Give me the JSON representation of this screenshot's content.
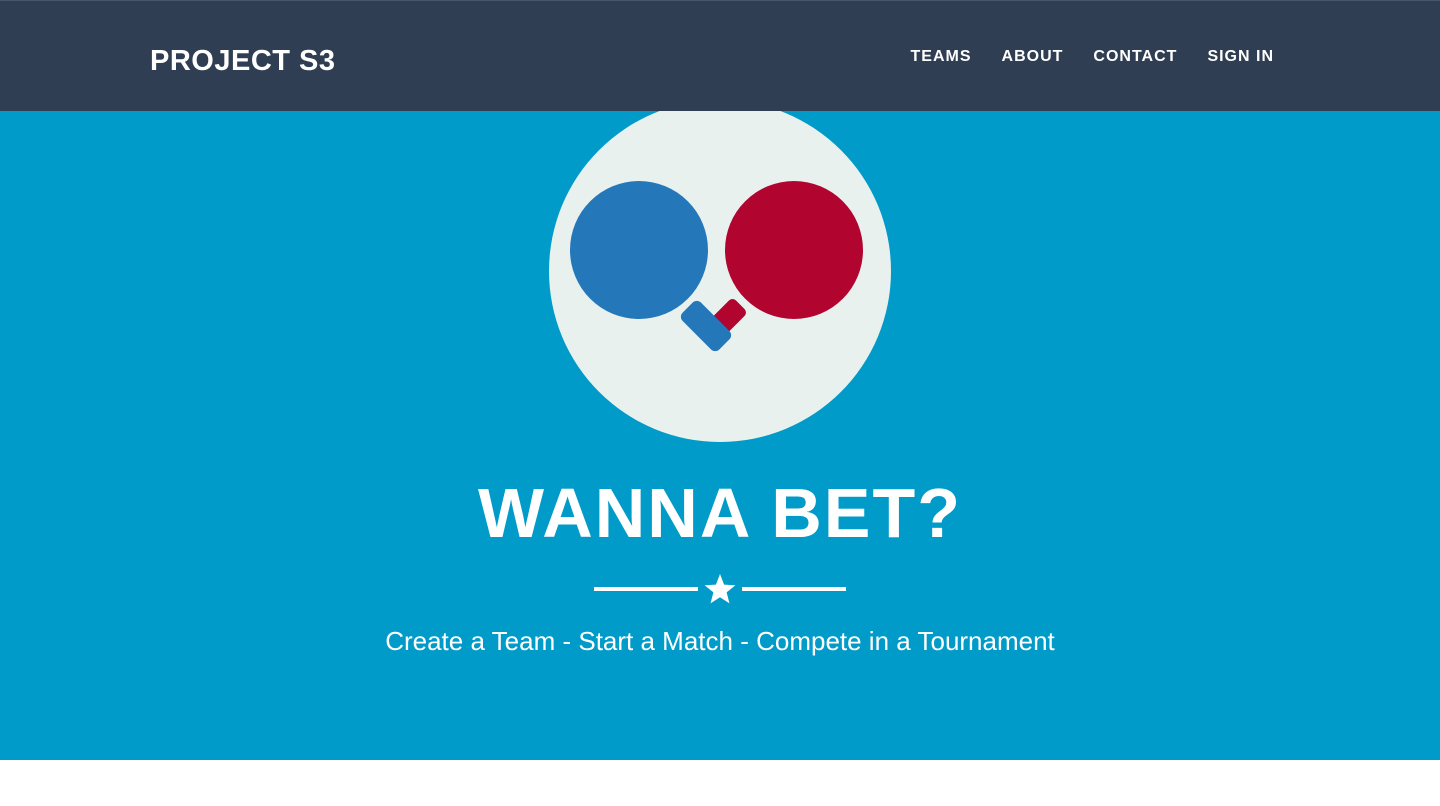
{
  "navbar": {
    "brand": "PROJECT S3",
    "links": [
      {
        "label": "TEAMS"
      },
      {
        "label": "ABOUT"
      },
      {
        "label": "CONTACT"
      },
      {
        "label": "SIGN IN"
      }
    ]
  },
  "hero": {
    "logo_icon": "ping-pong-paddles-icon",
    "headline": "WANNA BET?",
    "divider_icon": "star-icon",
    "tagline": "Create a Team - Start a Match - Compete in a Tournament"
  },
  "colors": {
    "navbar_bg": "#2f3e52",
    "hero_bg": "#009bc9",
    "logo_circle": "#e9f1ef",
    "paddle_blue": "#2478b9",
    "paddle_red": "#b10530",
    "text": "#ffffff"
  }
}
